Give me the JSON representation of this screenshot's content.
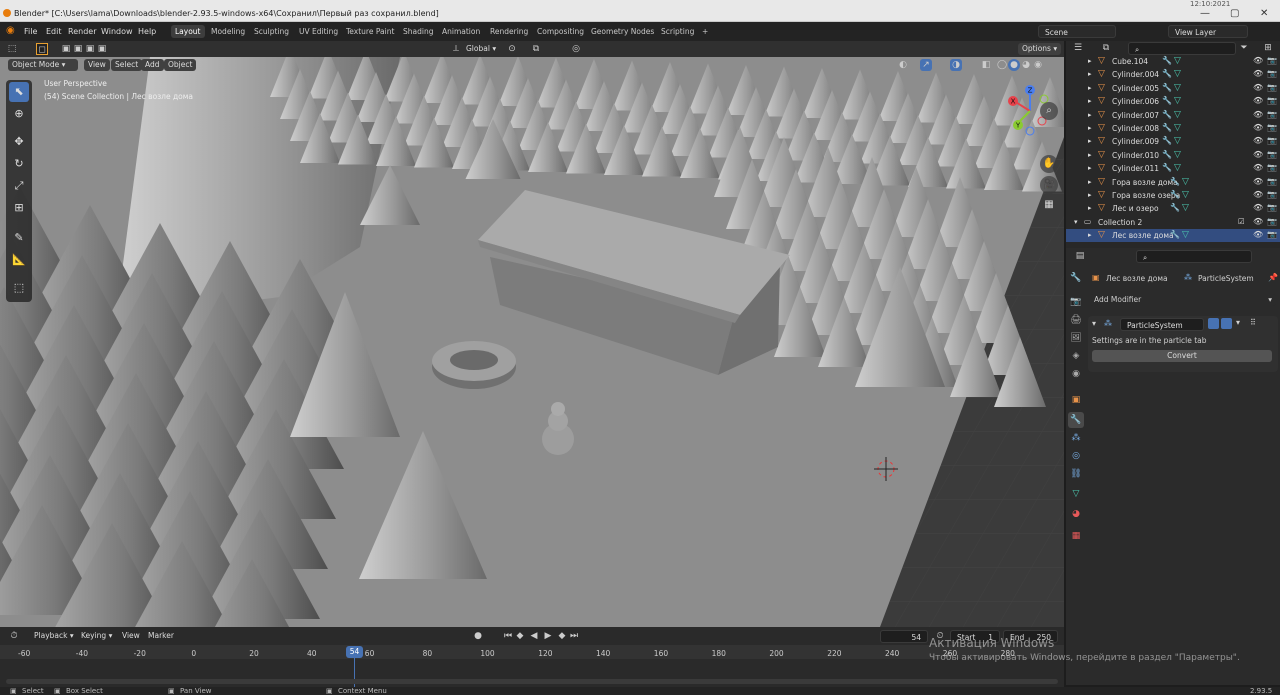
{
  "window": {
    "title": "Blender* [C:\\Users\\lama\\Downloads\\blender-2.93.5-windows-x64\\Сохранил\\Первый раз сохранил.blend]"
  },
  "menu": [
    "File",
    "Edit",
    "Render",
    "Window",
    "Help"
  ],
  "workspaces": [
    "Layout",
    "Modeling",
    "Sculpting",
    "UV Editing",
    "Texture Paint",
    "Shading",
    "Animation",
    "Rendering",
    "Compositing",
    "Geometry Nodes",
    "Scripting"
  ],
  "active_workspace": "Layout",
  "scene": "Scene",
  "view_layer": "View Layer",
  "header3d": {
    "mode": "Object Mode",
    "menus": [
      "View",
      "Select",
      "Add",
      "Object"
    ],
    "orientation": "Global",
    "options": "Options"
  },
  "viewport": {
    "perspective": "User Perspective",
    "collection": "(54) Scene Collection | Лес возле дома"
  },
  "outliner": {
    "rows": [
      {
        "name": "Cube.104"
      },
      {
        "name": "Cylinder.004"
      },
      {
        "name": "Cylinder.005"
      },
      {
        "name": "Cylinder.006"
      },
      {
        "name": "Cylinder.007"
      },
      {
        "name": "Cylinder.008"
      },
      {
        "name": "Cylinder.009"
      },
      {
        "name": "Cylinder.010"
      },
      {
        "name": "Cylinder.011"
      },
      {
        "name": "Гора возле дома"
      },
      {
        "name": "Гора возле озера"
      },
      {
        "name": "Лес и озеро"
      },
      {
        "name": "Collection 2"
      },
      {
        "name": "Лес возле дома"
      }
    ]
  },
  "properties": {
    "object": "Лес возле дома",
    "modifier_name": "ParticleSystem",
    "add_modifier": "Add Modifier",
    "modifier_field": "ParticleSystem",
    "message": "Settings are in the particle tab",
    "convert": "Convert"
  },
  "timeline": {
    "menus": [
      "Playback",
      "Keying",
      "View",
      "Marker"
    ],
    "current_frame": "54",
    "start_label": "Start",
    "start": "1",
    "end_label": "End",
    "end": "250",
    "ticks": [
      "-60",
      "-40",
      "-20",
      "0",
      "20",
      "40",
      "60",
      "80",
      "100",
      "120",
      "140",
      "160",
      "180",
      "200",
      "220",
      "240",
      "260",
      "280"
    ],
    "playhead": "54"
  },
  "activation": {
    "line1": "Активация Windows",
    "line2": "Чтобы активировать Windows, перейдите в раздел \"Параметры\"."
  },
  "status": {
    "select": "Select",
    "box_select": "Box Select",
    "pan_view": "Pan View",
    "context_menu": "Context Menu",
    "version": "2.93.5"
  },
  "clock": "12:10:2021"
}
